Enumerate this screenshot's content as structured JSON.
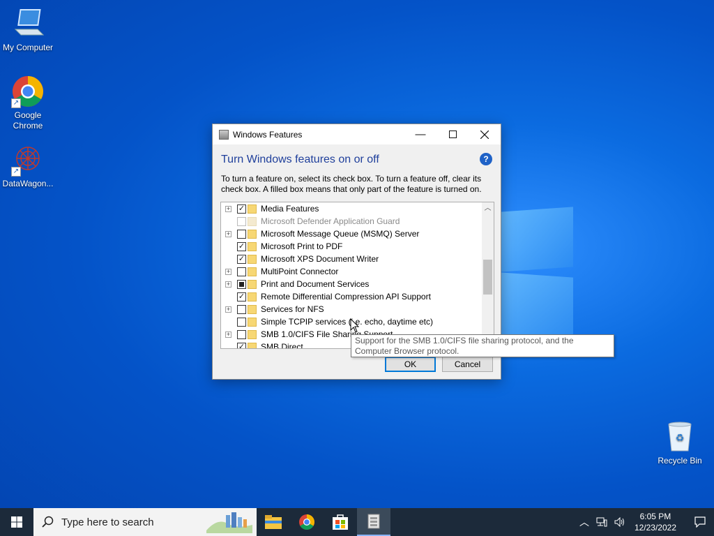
{
  "desktop": {
    "icons": [
      {
        "label": "My Computer"
      },
      {
        "label": "Google Chrome"
      },
      {
        "label": "DataWagon..."
      },
      {
        "label": "Recycle Bin"
      }
    ]
  },
  "dialog": {
    "title": "Windows Features",
    "heading": "Turn Windows features on or off",
    "help_glyph": "?",
    "description": "To turn a feature on, select its check box. To turn a feature off, clear its check box. A filled box means that only part of the feature is turned on.",
    "features": [
      {
        "label": "Media Features",
        "state": "checked",
        "expandable": true
      },
      {
        "label": "Microsoft Defender Application Guard",
        "state": "disabled",
        "expandable": false
      },
      {
        "label": "Microsoft Message Queue (MSMQ) Server",
        "state": "unchecked",
        "expandable": true
      },
      {
        "label": "Microsoft Print to PDF",
        "state": "checked",
        "expandable": false
      },
      {
        "label": "Microsoft XPS Document Writer",
        "state": "checked",
        "expandable": false
      },
      {
        "label": "MultiPoint Connector",
        "state": "unchecked",
        "expandable": true
      },
      {
        "label": "Print and Document Services",
        "state": "partial",
        "expandable": true
      },
      {
        "label": "Remote Differential Compression API Support",
        "state": "checked",
        "expandable": false
      },
      {
        "label": "Services for NFS",
        "state": "unchecked",
        "expandable": true
      },
      {
        "label": "Simple TCPIP services (i.e. echo, daytime etc)",
        "state": "unchecked",
        "expandable": false
      },
      {
        "label": "SMB 1.0/CIFS File Sharing Support",
        "state": "unchecked",
        "expandable": true
      },
      {
        "label": "SMB Direct",
        "state": "checked",
        "expandable": false
      }
    ],
    "ok_label": "OK",
    "cancel_label": "Cancel",
    "tooltip": "Support for the SMB 1.0/CIFS file sharing protocol, and the Computer Browser protocol."
  },
  "taskbar": {
    "search_placeholder": "Type here to search",
    "time": "6:05 PM",
    "date": "12/23/2022"
  },
  "icons": {
    "start": "windows-start-icon",
    "search": "search-icon",
    "explorer": "file-explorer-icon",
    "chrome": "chrome-icon",
    "store": "store-icon",
    "features": "windows-features-icon"
  }
}
